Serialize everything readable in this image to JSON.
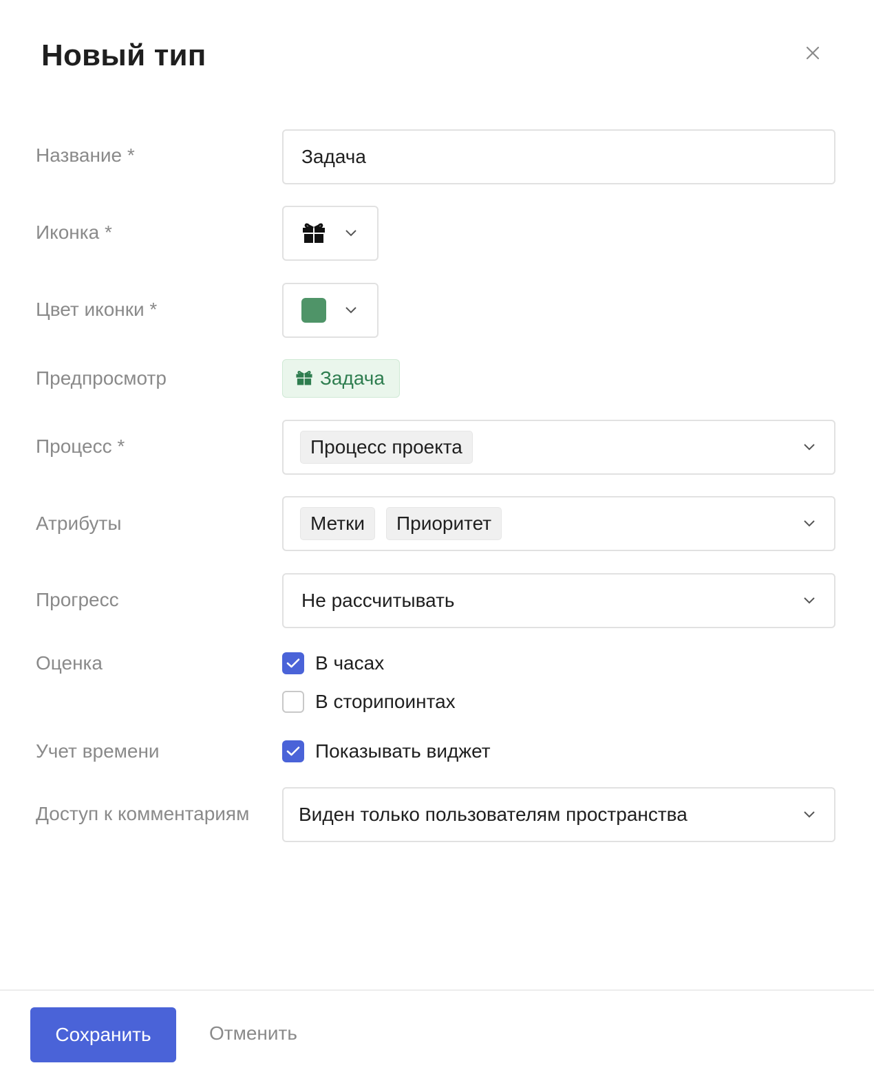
{
  "dialog": {
    "title": "Новый тип"
  },
  "fields": {
    "name_label": "Название *",
    "name_value": "Задача",
    "icon_label": "Иконка *",
    "icon_value": "gift-icon",
    "color_label": "Цвет иконки *",
    "color_value": "#4f9468",
    "preview_label": "Предпросмотр",
    "preview_text": "Задача",
    "process_label": "Процесс *",
    "process_value": "Процесс проекта",
    "attributes_label": "Атрибуты",
    "attributes": [
      "Метки",
      "Приоритет"
    ],
    "progress_label": "Прогресс",
    "progress_value": "Не рассчитывать",
    "estimate_label": "Оценка",
    "estimate_hours_label": "В часах",
    "estimate_hours_checked": true,
    "estimate_points_label": "В сторипоинтах",
    "estimate_points_checked": false,
    "time_label": "Учет времени",
    "time_widget_label": "Показывать виджет",
    "time_widget_checked": true,
    "comments_label": "Доступ к комментариям",
    "comments_value": "Виден только пользователям пространства"
  },
  "footer": {
    "save_label": "Сохранить",
    "cancel_label": "Отменить"
  },
  "colors": {
    "accent": "#4a63d8",
    "preview_bg": "#eaf6ec",
    "preview_text": "#2e7d4f"
  }
}
